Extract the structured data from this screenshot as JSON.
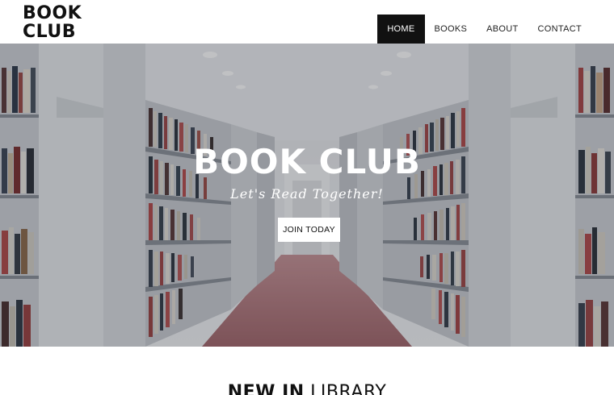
{
  "header": {
    "logo_line1": "BOOK",
    "logo_line2": "CLUB",
    "nav": [
      {
        "label": "HOME",
        "active": true
      },
      {
        "label": "BOOKS",
        "active": false
      },
      {
        "label": "ABOUT",
        "active": false
      },
      {
        "label": "CONTACT",
        "active": false
      }
    ]
  },
  "hero": {
    "title": "BOOK CLUB",
    "tagline": "Let's Read Together!",
    "cta_label": "JOIN TODAY",
    "image": "library-aisle-bookshelves"
  },
  "section": {
    "heading_strong": "NEW IN",
    "heading_light": "LIBRARY"
  },
  "colors": {
    "nav_active_bg": "#111111",
    "floor": "#a46a6e",
    "shelf": "#d6d9de"
  }
}
